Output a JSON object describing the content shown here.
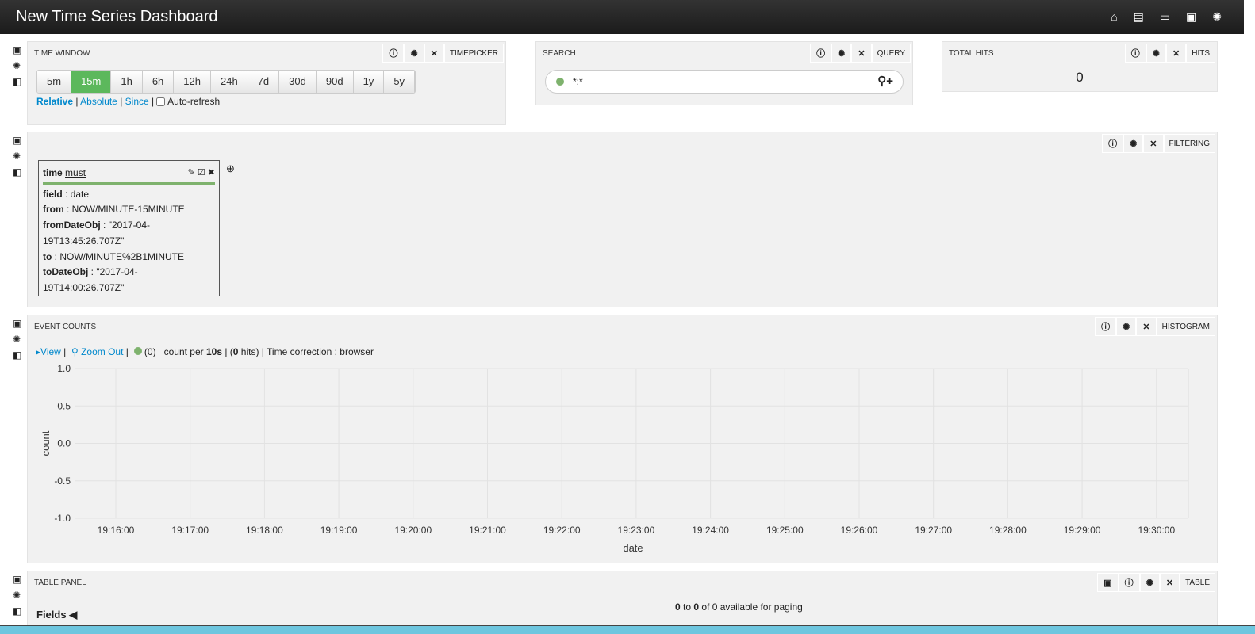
{
  "header": {
    "title": "New Time Series Dashboard",
    "icons": [
      "home-icon",
      "file-icon",
      "folder-open-icon",
      "save-icon",
      "gear-icon"
    ]
  },
  "timepicker": {
    "title": "TIME WINDOW",
    "type_label": "TIMEPICKER",
    "ranges": [
      "5m",
      "15m",
      "1h",
      "6h",
      "12h",
      "24h",
      "7d",
      "30d",
      "90d",
      "1y",
      "5y"
    ],
    "active": "15m",
    "modes": {
      "relative": "Relative",
      "absolute": "Absolute",
      "since": "Since"
    },
    "autorefresh": "Auto-refresh",
    "autorefresh_checked": false
  },
  "query": {
    "title": "SEARCH",
    "type_label": "QUERY",
    "value": "*:*"
  },
  "hits": {
    "title": "TOTAL HITS",
    "type_label": "HITS",
    "value": "0"
  },
  "filtering": {
    "type_label": "FILTERING",
    "filter": {
      "name": "time",
      "mandate": "must",
      "lines": [
        [
          "field",
          " : date"
        ],
        [
          "from",
          " : NOW/MINUTE-15MINUTE"
        ],
        [
          "fromDateObj",
          " : \"2017-04-"
        ],
        [
          "",
          " 19T13:45:26.707Z\""
        ],
        [
          "to",
          " : NOW/MINUTE%2B1MINUTE"
        ],
        [
          "toDateObj",
          " : \"2017-04-"
        ],
        [
          "",
          " 19T14:00:26.707Z\""
        ]
      ]
    }
  },
  "histogram": {
    "title": "EVENT COUNTS",
    "type_label": "HISTOGRAM",
    "view": "View",
    "zoom_out": "Zoom Out",
    "legend_count": "(0)",
    "count_per": "count per ",
    "interval": "10s",
    "hits_open": " | (",
    "hits_value": "0",
    "hits_close": " hits) | Time correction : browser"
  },
  "chart_data": {
    "type": "bar",
    "xlabel": "date",
    "ylabel": "count",
    "ylim": [
      -1,
      1
    ],
    "yticks": [
      "1.0",
      "0.5",
      "0.0",
      "-0.5",
      "-1.0"
    ],
    "xticks": [
      "19:16:00",
      "19:17:00",
      "19:18:00",
      "19:19:00",
      "19:20:00",
      "19:21:00",
      "19:22:00",
      "19:23:00",
      "19:24:00",
      "19:25:00",
      "19:26:00",
      "19:27:00",
      "19:28:00",
      "19:29:00",
      "19:30:00"
    ],
    "series": [
      {
        "name": "*:*",
        "color": "#7eb26d",
        "values": []
      }
    ],
    "grid": true
  },
  "table": {
    "title": "TABLE PANEL",
    "type_label": "TABLE",
    "fields_label": "Fields",
    "paging_from": "0",
    "paging_to_word": " to ",
    "paging_to": "0",
    "paging_rest": " of 0 available for paging"
  }
}
